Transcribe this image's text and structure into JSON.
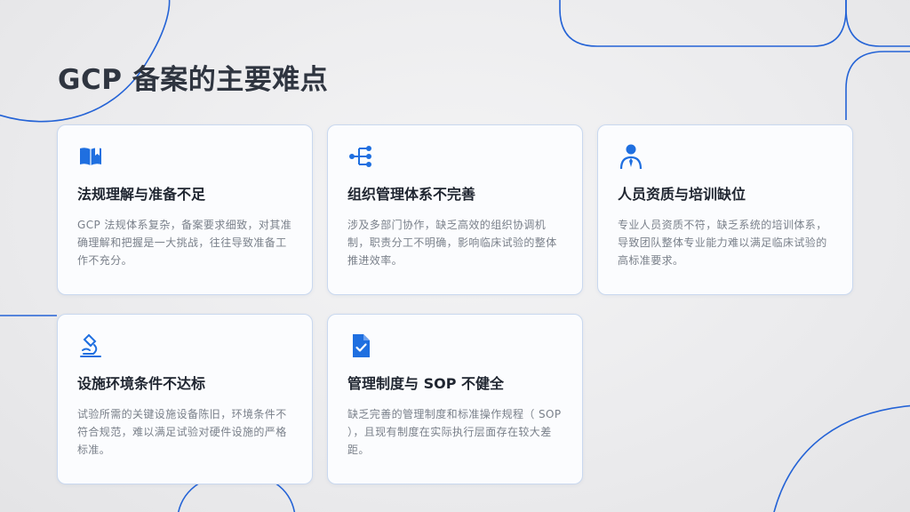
{
  "slide": {
    "title": "GCP 备案的主要难点"
  },
  "accent_color": "#1f6fe0",
  "cards": [
    {
      "icon": "book-icon",
      "title": "法规理解与准备不足",
      "desc": "GCP 法规体系复杂，备案要求细致，对其准确理解和把握是一大挑战，往往导致准备工作不充分。"
    },
    {
      "icon": "org-tree-icon",
      "title": "组织管理体系不完善",
      "desc": "涉及多部门协作，缺乏高效的组织协调机制，职责分工不明确，影响临床试验的整体推进效率。"
    },
    {
      "icon": "person-tie-icon",
      "title": "人员资质与培训缺位",
      "desc": "专业人员资质不符，缺乏系统的培训体系，导致团队整体专业能力难以满足临床试验的高标准要求。"
    },
    {
      "icon": "microscope-icon",
      "title": "设施环境条件不达标",
      "desc": "试验所需的关键设施设备陈旧，环境条件不符合规范，难以满足试验对硬件设施的严格标准。"
    },
    {
      "icon": "document-check-icon",
      "title": "管理制度与 SOP 不健全",
      "desc": "缺乏完善的管理制度和标准操作规程（ SOP ），且现有制度在实际执行层面存在较大差距。"
    }
  ]
}
